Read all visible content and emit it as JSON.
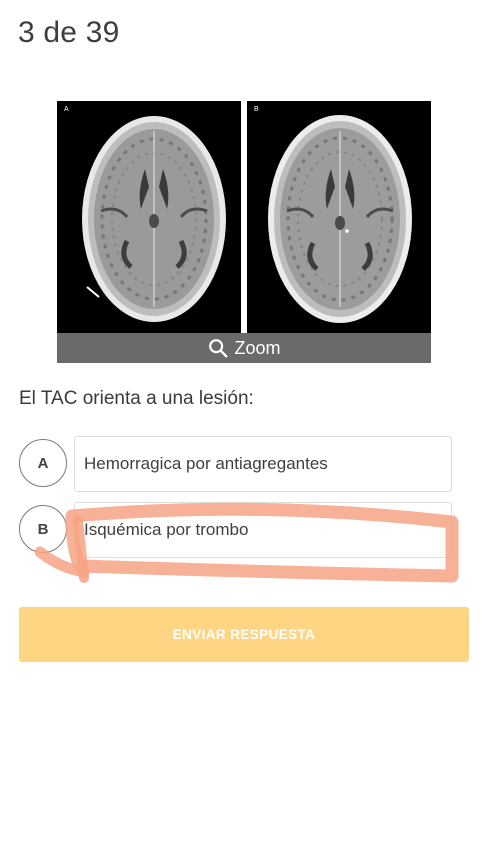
{
  "header": {
    "counter": "3 de 39"
  },
  "figure": {
    "panel_a_label": "A",
    "panel_b_label": "B",
    "zoom_label": "Zoom"
  },
  "question": {
    "text": "El TAC orienta a una lesión:"
  },
  "options": [
    {
      "letter": "A",
      "text": "Hemorragica por antiagregantes"
    },
    {
      "letter": "B",
      "text": "Isquémica por trombo"
    }
  ],
  "submit": {
    "label": "ENVIAR RESPUESTA"
  },
  "colors": {
    "submit_bg": "#fdd583",
    "annotation_stroke": "#f59a78"
  }
}
